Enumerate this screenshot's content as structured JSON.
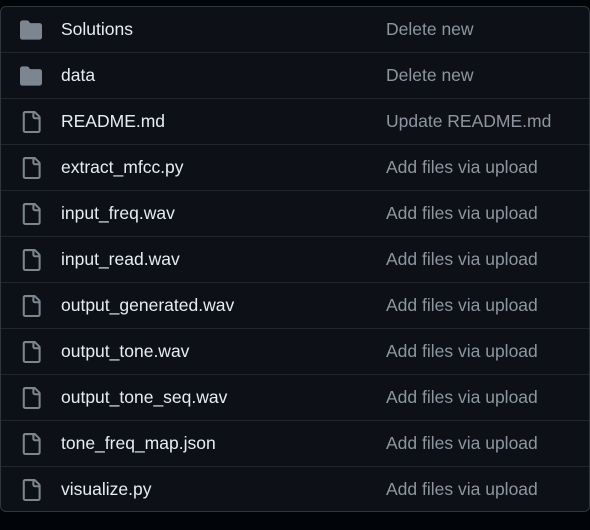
{
  "colors": {
    "background": "#0d1117",
    "border": "#30363d",
    "row_divider": "#21262d",
    "file_name": "#e6edf3",
    "commit_message": "#8d96a0",
    "folder_icon": "#7d8590",
    "file_icon": "#7d8590"
  },
  "files": [
    {
      "type": "directory",
      "icon": "folder-icon",
      "name": "Solutions",
      "commit": "Delete new"
    },
    {
      "type": "directory",
      "icon": "folder-icon",
      "name": "data",
      "commit": "Delete new"
    },
    {
      "type": "file",
      "icon": "file-icon",
      "name": "README.md",
      "commit": "Update README.md"
    },
    {
      "type": "file",
      "icon": "file-icon",
      "name": "extract_mfcc.py",
      "commit": "Add files via upload"
    },
    {
      "type": "file",
      "icon": "file-icon",
      "name": "input_freq.wav",
      "commit": "Add files via upload"
    },
    {
      "type": "file",
      "icon": "file-icon",
      "name": "input_read.wav",
      "commit": "Add files via upload"
    },
    {
      "type": "file",
      "icon": "file-icon",
      "name": "output_generated.wav",
      "commit": "Add files via upload"
    },
    {
      "type": "file",
      "icon": "file-icon",
      "name": "output_tone.wav",
      "commit": "Add files via upload"
    },
    {
      "type": "file",
      "icon": "file-icon",
      "name": "output_tone_seq.wav",
      "commit": "Add files via upload"
    },
    {
      "type": "file",
      "icon": "file-icon",
      "name": "tone_freq_map.json",
      "commit": "Add files via upload"
    },
    {
      "type": "file",
      "icon": "file-icon",
      "name": "visualize.py",
      "commit": "Add files via upload"
    }
  ]
}
